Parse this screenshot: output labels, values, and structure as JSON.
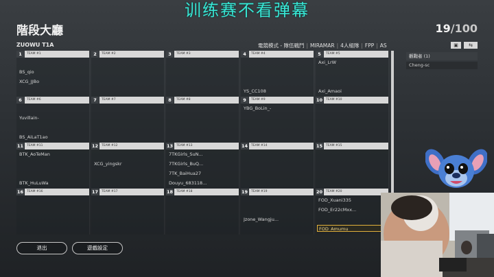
{
  "overlay_title": "训练赛不看弹幕",
  "lobby": {
    "title": "階段大廳",
    "count_current": "19",
    "count_max": "/100",
    "room_name": "ZUOWU T1A"
  },
  "mode_bar": [
    "電競模式 - 隊伍戰鬥",
    "MIRAMAR",
    "4人組隊",
    "FPP",
    "AS"
  ],
  "spectators": {
    "header": "觀戰者 (1)",
    "items": [
      "Cheng-sc"
    ]
  },
  "buttons": {
    "exit": "退出",
    "settings": "遊戲設定"
  },
  "teams": [
    {
      "num": "1",
      "label": "TEAM #1",
      "slots": [
        "",
        "BS_qio",
        "XCG_JJBo",
        ""
      ]
    },
    {
      "num": "2",
      "label": "TEAM #2",
      "slots": [
        "",
        "",
        "",
        ""
      ]
    },
    {
      "num": "3",
      "label": "TEAM #3",
      "slots": [
        "",
        "",
        "",
        ""
      ]
    },
    {
      "num": "4",
      "label": "TEAM #4",
      "slots": [
        "",
        "",
        "",
        "YS_CC108"
      ]
    },
    {
      "num": "5",
      "label": "TEAM #5",
      "slots": [
        "Axi_LrW",
        "",
        "",
        "Axi_Amaoi"
      ]
    },
    {
      "num": "6",
      "label": "TEAM #6",
      "slots": [
        "",
        "Yuvillain-",
        "",
        "BS_AiLaT1ao"
      ]
    },
    {
      "num": "7",
      "label": "TEAM #7",
      "slots": [
        "",
        "",
        "",
        ""
      ]
    },
    {
      "num": "8",
      "label": "TEAM #8",
      "slots": [
        "",
        "",
        "",
        ""
      ]
    },
    {
      "num": "9",
      "label": "TEAM #9",
      "slots": [
        "YBG_BoLin_-",
        "",
        "",
        ""
      ]
    },
    {
      "num": "10",
      "label": "TEAM #10",
      "slots": [
        "",
        "",
        "",
        ""
      ]
    },
    {
      "num": "11",
      "label": "TEAM #11",
      "slots": [
        "BTK_AoTeMan",
        "",
        "",
        "BTK_HuLuWa"
      ]
    },
    {
      "num": "12",
      "label": "TEAM #12",
      "slots": [
        "",
        "XCG_yingskr",
        "",
        ""
      ]
    },
    {
      "num": "13",
      "label": "TEAM #13",
      "slots": [
        "7TKGirls_SuN...",
        "7TKGirls_BuQ...",
        "7TK_BaiHua27",
        "Douyu_683118..."
      ]
    },
    {
      "num": "14",
      "label": "TEAM #14",
      "slots": [
        "",
        "",
        "",
        ""
      ]
    },
    {
      "num": "15",
      "label": "TEAM #15",
      "slots": [
        "",
        "",
        "",
        ""
      ]
    },
    {
      "num": "16",
      "label": "TEAM #16",
      "slots": [
        "",
        "",
        "",
        ""
      ]
    },
    {
      "num": "17",
      "label": "TEAM #17",
      "slots": [
        "",
        "",
        "",
        ""
      ]
    },
    {
      "num": "18",
      "label": "TEAM #18",
      "slots": [
        "",
        "",
        "",
        ""
      ]
    },
    {
      "num": "19",
      "label": "TEAM #19",
      "slots": [
        "",
        "",
        "Jzone_Wangju...",
        ""
      ]
    },
    {
      "num": "20",
      "label": "TEAM #20",
      "slots": [
        "FOD_Xuani335",
        "FOD_Er22cMxx...",
        "",
        "FOD_Amumu"
      ]
    }
  ],
  "highlighted_player": "FOD_Amumu",
  "colors": {
    "overlay_text": "#39e6d4",
    "highlight_border": "#e3b23c"
  },
  "icons": {
    "lock": "lock-icon",
    "swap": "swap-icon"
  }
}
